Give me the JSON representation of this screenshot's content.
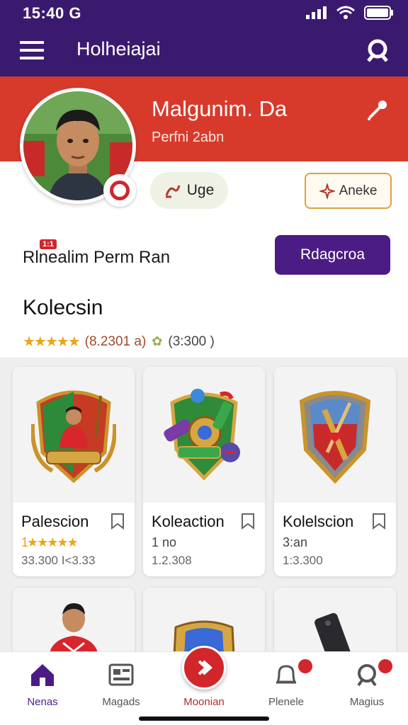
{
  "status_bar": {
    "time": "15:40 G"
  },
  "app_bar": {
    "title": "Holheiajai",
    "menu_icon": "hamburger-icon",
    "search_icon": "search-icon"
  },
  "colors": {
    "app_bar": "#3a1a6e",
    "banner": "#d73a2b",
    "primary_button": "#4b1d84",
    "accent_red": "#d1262c",
    "star": "#e8a719"
  },
  "profile": {
    "name": "Malgunim. Da",
    "subtitle": "Perfni 2abn",
    "edit_icon": "pencil-icon",
    "chip_label": "Uge",
    "outline_button": "Aneke",
    "new_tag": "1:1",
    "row_label": "Rlnealim Perm Ran",
    "primary_button": "Rdagcroa"
  },
  "collection": {
    "title": "Kolecsin",
    "rating_stars": "★★★★★",
    "rating_value": "(8.2301 a)",
    "count": "(3:300 )"
  },
  "cards": [
    {
      "title": "Palescion",
      "line2_stars": "1★★★★★",
      "line3": "33.300 I<3.33",
      "image": "football-player-shield-emblem"
    },
    {
      "title": "Koleaction",
      "line2": "1 no",
      "line3": "1.2.308",
      "image": "colorful-items-shield-emblem"
    },
    {
      "title": "Kolelscion",
      "line2": "3:an",
      "line3": "1:3.300",
      "image": "armored-shield-emblem"
    }
  ],
  "bottom_nav": [
    {
      "label": "Nenas",
      "icon": "home-icon",
      "active": true
    },
    {
      "label": "Magads",
      "icon": "cards-icon"
    },
    {
      "label": "Moonian",
      "icon": "chevron-right-icon"
    },
    {
      "label": "Plenele",
      "icon": "bell-icon"
    },
    {
      "label": "Magius",
      "icon": "search-icon"
    }
  ]
}
